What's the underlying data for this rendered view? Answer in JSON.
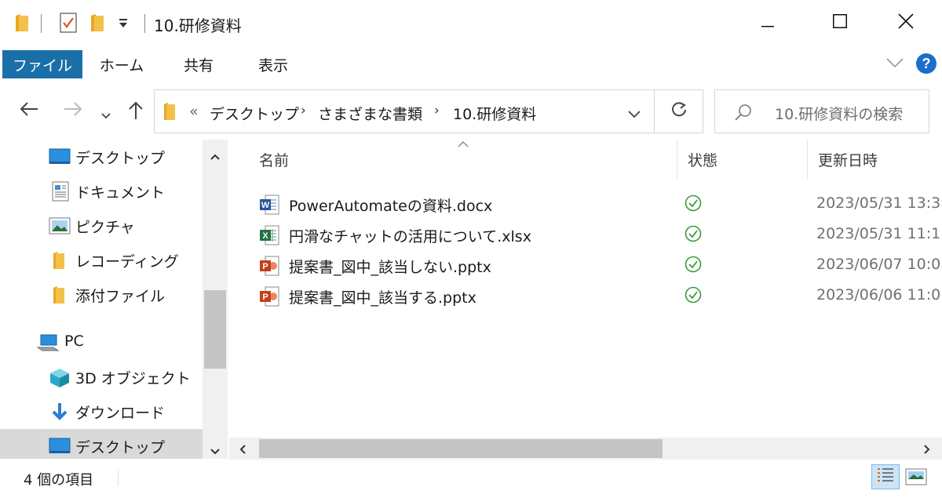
{
  "window": {
    "title": "10.研修資料"
  },
  "ribbon": {
    "tabs": [
      "ファイル",
      "ホーム",
      "共有",
      "表示"
    ]
  },
  "address": {
    "overflow": "«",
    "crumbs": [
      "デスクトップ",
      "さまざまな書類",
      "10.研修資料"
    ],
    "search_placeholder": "10.研修資料の検索"
  },
  "sidebar": {
    "quick_access": [
      "デスクトップ",
      "ドキュメント",
      "ピクチャ",
      "レコーディング",
      "添付ファイル"
    ],
    "pc_label": "PC",
    "pc_items": [
      "3D オブジェクト",
      "ダウンロード",
      "デスクトップ"
    ]
  },
  "columns": {
    "name": "名前",
    "status": "状態",
    "modified": "更新日時"
  },
  "files": [
    {
      "name": "PowerAutomateの資料.docx",
      "type": "word",
      "modified": "2023/05/31 13:3"
    },
    {
      "name": "円滑なチャットの活用について.xlsx",
      "type": "excel",
      "modified": "2023/05/31 11:1"
    },
    {
      "name": "提案書_図中_該当しない.pptx",
      "type": "powerpoint",
      "modified": "2023/06/07 10:0"
    },
    {
      "name": "提案書_図中_該当する.pptx",
      "type": "powerpoint",
      "modified": "2023/06/06 11:0"
    }
  ],
  "statusbar": {
    "item_count": "4 個の項目"
  },
  "colors": {
    "accent": "#1a6fa8",
    "word": "#2b579a",
    "excel": "#217346",
    "powerpoint": "#c43e1c",
    "sync_ok": "#3a9a3a",
    "folder": "#f4c04a"
  }
}
